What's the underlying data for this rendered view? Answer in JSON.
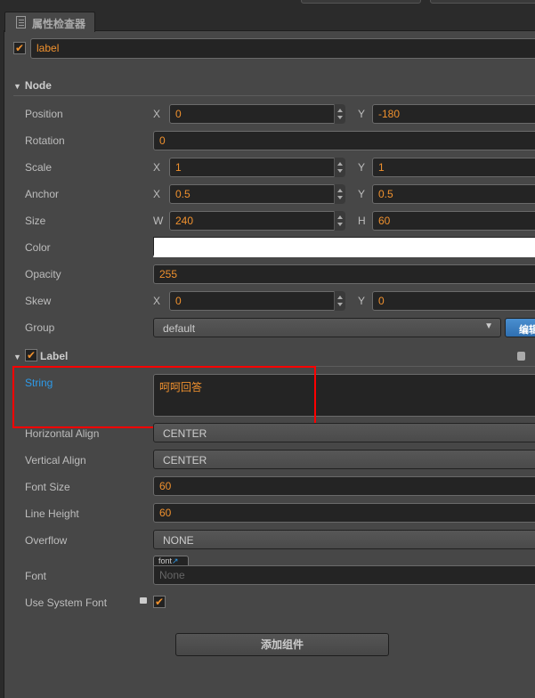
{
  "panel": {
    "title": "属性检查器"
  },
  "node_name": {
    "value": "label",
    "enabled": true
  },
  "node": {
    "header": "Node",
    "position": {
      "label": "Position",
      "x": "0",
      "y": "-180"
    },
    "rotation": {
      "label": "Rotation",
      "value": "0"
    },
    "scale": {
      "label": "Scale",
      "x": "1",
      "y": "1"
    },
    "anchor": {
      "label": "Anchor",
      "x": "0.5",
      "y": "0.5"
    },
    "size": {
      "label": "Size",
      "w": "240",
      "h": "60"
    },
    "color": {
      "label": "Color",
      "value": "#ffffff"
    },
    "opacity": {
      "label": "Opacity",
      "value": "255"
    },
    "skew": {
      "label": "Skew",
      "x": "0",
      "y": "0"
    },
    "group": {
      "label": "Group",
      "value": "default",
      "edit": "编辑"
    },
    "axes": {
      "x": "X",
      "y": "Y",
      "w": "W",
      "h": "H"
    }
  },
  "label_comp": {
    "header": "Label",
    "enabled": true,
    "string": {
      "label": "String",
      "value": "呵呵回答"
    },
    "halign": {
      "label": "Horizontal Align",
      "value": "CENTER"
    },
    "valign": {
      "label": "Vertical Align",
      "value": "CENTER"
    },
    "font_size": {
      "label": "Font Size",
      "value": "60"
    },
    "line_height": {
      "label": "Line Height",
      "value": "60"
    },
    "overflow": {
      "label": "Overflow",
      "value": "NONE"
    },
    "font": {
      "label": "Font",
      "tag": "font",
      "value": "None"
    },
    "system_font": {
      "label": "Use System Font",
      "checked": true
    }
  },
  "add_component": "添加组件"
}
